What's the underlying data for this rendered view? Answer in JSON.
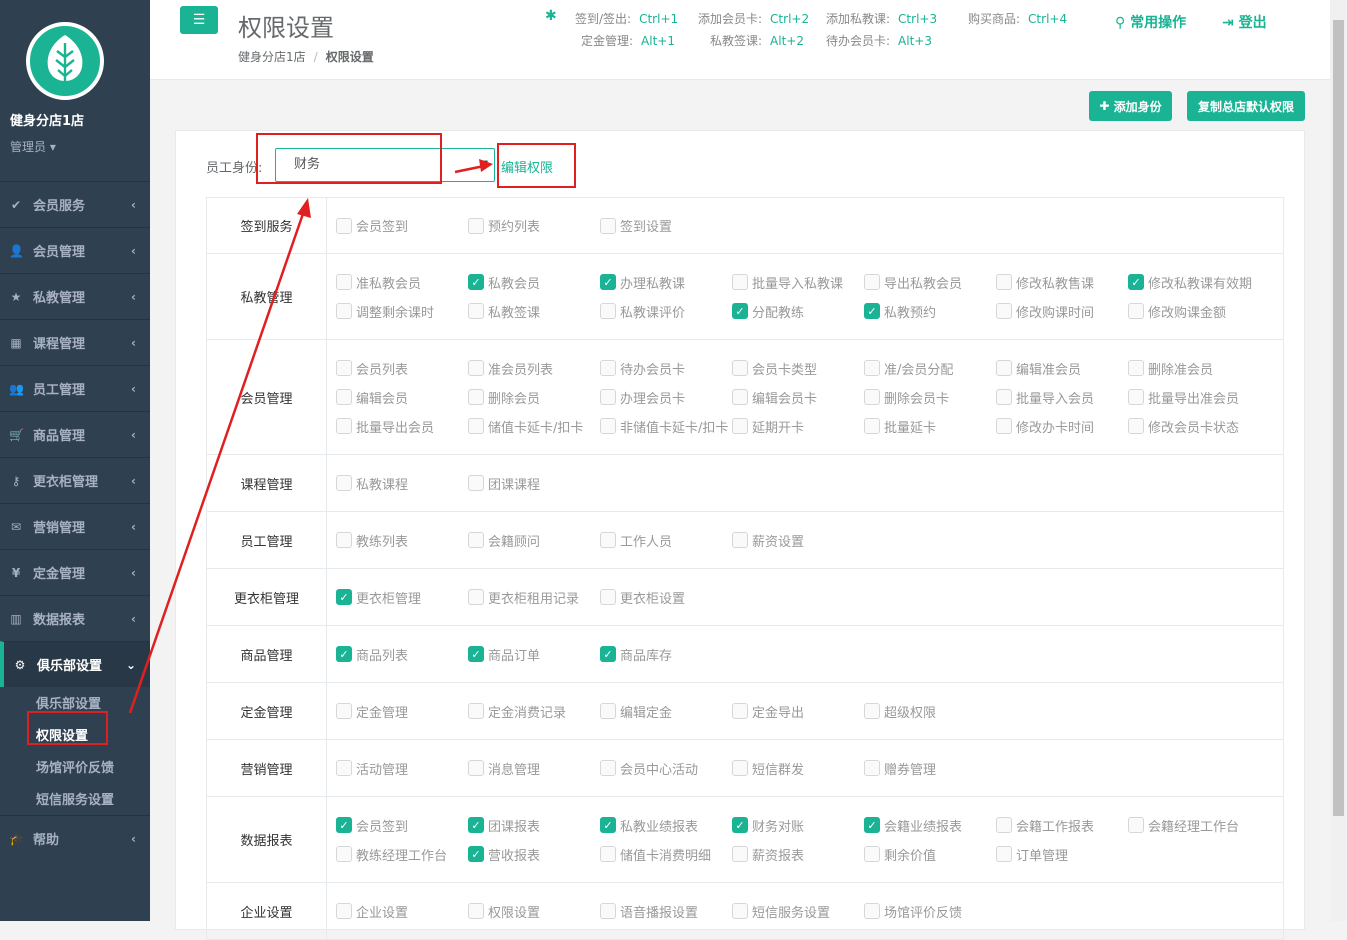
{
  "sidebar": {
    "shop_name": "健身分店1店",
    "role": "管理员",
    "items": [
      {
        "label": "会员服务",
        "icon": "check-icon",
        "glyph": "✔"
      },
      {
        "label": "会员管理",
        "icon": "user-icon",
        "glyph": "👤"
      },
      {
        "label": "私教管理",
        "icon": "star-icon",
        "glyph": "★"
      },
      {
        "label": "课程管理",
        "icon": "calendar-icon",
        "glyph": "▦"
      },
      {
        "label": "员工管理",
        "icon": "users-icon",
        "glyph": "👥"
      },
      {
        "label": "商品管理",
        "icon": "cart-icon",
        "glyph": "🛒"
      },
      {
        "label": "更衣柜管理",
        "icon": "key-icon",
        "glyph": "⚷"
      },
      {
        "label": "营销管理",
        "icon": "envelope-icon",
        "glyph": "✉"
      },
      {
        "label": "定金管理",
        "icon": "yen-icon",
        "glyph": "¥"
      },
      {
        "label": "数据报表",
        "icon": "bar-chart-icon",
        "glyph": "▥"
      }
    ],
    "active": {
      "label": "俱乐部设置",
      "icon": "gear-icon",
      "glyph": "⚙"
    },
    "sub_items": [
      "俱乐部设置",
      "权限设置",
      "场馆评价反馈",
      "短信服务设置"
    ],
    "help": {
      "label": "帮助",
      "icon": "graduation-cap-icon",
      "glyph": "🎓"
    }
  },
  "header": {
    "title": "权限设置",
    "breadcrumb": [
      "健身分店1店",
      "权限设置"
    ],
    "shortcuts_row1": [
      {
        "label": "签到/签出:",
        "key": "Ctrl+1"
      },
      {
        "label": "添加会员卡:",
        "key": "Ctrl+2"
      },
      {
        "label": "添加私教课:",
        "key": "Ctrl+3"
      },
      {
        "label": "购买商品:",
        "key": "Ctrl+4"
      }
    ],
    "shortcuts_row2": [
      {
        "label": "定金管理:",
        "key": "Alt+1"
      },
      {
        "label": "私教签课:",
        "key": "Alt+2"
      },
      {
        "label": "待办会员卡:",
        "key": "Alt+3"
      }
    ],
    "common_ops": "常用操作",
    "logout": "登出"
  },
  "actions": {
    "add_role": "添加身份",
    "copy_default": "复制总店默认权限"
  },
  "form": {
    "role_label": "员工身份:",
    "role_value": "财务",
    "edit_label": "编辑权限"
  },
  "permissions": [
    {
      "category": "签到服务",
      "items": [
        [
          "会员签到",
          false
        ],
        [
          "预约列表",
          false
        ],
        [
          "签到设置",
          false
        ]
      ]
    },
    {
      "category": "私教管理",
      "items": [
        [
          "准私教会员",
          false
        ],
        [
          "私教会员",
          true
        ],
        [
          "办理私教课",
          true
        ],
        [
          "批量导入私教课",
          false
        ],
        [
          "导出私教会员",
          false
        ],
        [
          "修改私教售课",
          false
        ],
        [
          "修改私教课有效期",
          true
        ],
        [
          "调整剩余课时",
          false
        ],
        [
          "私教签课",
          false
        ],
        [
          "私教课评价",
          false
        ],
        [
          "分配教练",
          true
        ],
        [
          "私教预约",
          true
        ],
        [
          "修改购课时间",
          false
        ],
        [
          "修改购课金额",
          false
        ]
      ]
    },
    {
      "category": "会员管理",
      "items": [
        [
          "会员列表",
          false
        ],
        [
          "准会员列表",
          false
        ],
        [
          "待办会员卡",
          false
        ],
        [
          "会员卡类型",
          false
        ],
        [
          "准/会员分配",
          false
        ],
        [
          "编辑准会员",
          false
        ],
        [
          "删除准会员",
          false
        ],
        [
          "编辑会员",
          false
        ],
        [
          "删除会员",
          false
        ],
        [
          "办理会员卡",
          false
        ],
        [
          "编辑会员卡",
          false
        ],
        [
          "删除会员卡",
          false
        ],
        [
          "批量导入会员",
          false
        ],
        [
          "批量导出准会员",
          false
        ],
        [
          "批量导出会员",
          false
        ],
        [
          "储值卡延卡/扣卡",
          false
        ],
        [
          "非储值卡延卡/扣卡",
          false
        ],
        [
          "延期开卡",
          false
        ],
        [
          "批量延卡",
          false
        ],
        [
          "修改办卡时间",
          false
        ],
        [
          "修改会员卡状态",
          false
        ]
      ]
    },
    {
      "category": "课程管理",
      "items": [
        [
          "私教课程",
          false
        ],
        [
          "团课课程",
          false
        ]
      ]
    },
    {
      "category": "员工管理",
      "items": [
        [
          "教练列表",
          false
        ],
        [
          "会籍顾问",
          false
        ],
        [
          "工作人员",
          false
        ],
        [
          "薪资设置",
          false
        ]
      ]
    },
    {
      "category": "更衣柜管理",
      "items": [
        [
          "更衣柜管理",
          true
        ],
        [
          "更衣柜租用记录",
          false
        ],
        [
          "更衣柜设置",
          false
        ]
      ]
    },
    {
      "category": "商品管理",
      "items": [
        [
          "商品列表",
          true
        ],
        [
          "商品订单",
          true
        ],
        [
          "商品库存",
          true
        ]
      ]
    },
    {
      "category": "定金管理",
      "items": [
        [
          "定金管理",
          false
        ],
        [
          "定金消费记录",
          false
        ],
        [
          "编辑定金",
          false
        ],
        [
          "定金导出",
          false
        ],
        [
          "超级权限",
          false
        ]
      ]
    },
    {
      "category": "营销管理",
      "items": [
        [
          "活动管理",
          false
        ],
        [
          "消息管理",
          false
        ],
        [
          "会员中心活动",
          false
        ],
        [
          "短信群发",
          false
        ],
        [
          "赠券管理",
          false
        ]
      ]
    },
    {
      "category": "数据报表",
      "items": [
        [
          "会员签到",
          true
        ],
        [
          "团课报表",
          true
        ],
        [
          "私教业绩报表",
          true
        ],
        [
          "财务对账",
          true
        ],
        [
          "会籍业绩报表",
          true
        ],
        [
          "会籍工作报表",
          false
        ],
        [
          "会籍经理工作台",
          false
        ],
        [
          "教练经理工作台",
          false
        ],
        [
          "营收报表",
          true
        ],
        [
          "储值卡消费明细",
          false
        ],
        [
          "薪资报表",
          false
        ],
        [
          "剩余价值",
          false
        ],
        [
          "订单管理",
          false
        ]
      ]
    },
    {
      "category": "企业设置",
      "items": [
        [
          "企业设置",
          false
        ],
        [
          "权限设置",
          false
        ],
        [
          "语音播报设置",
          false
        ],
        [
          "短信服务设置",
          false
        ],
        [
          "场馆评价反馈",
          false
        ]
      ]
    }
  ],
  "colors": {
    "accent": "#1ab394",
    "sidebar": "#2f4050",
    "annotation": "#e02020"
  }
}
